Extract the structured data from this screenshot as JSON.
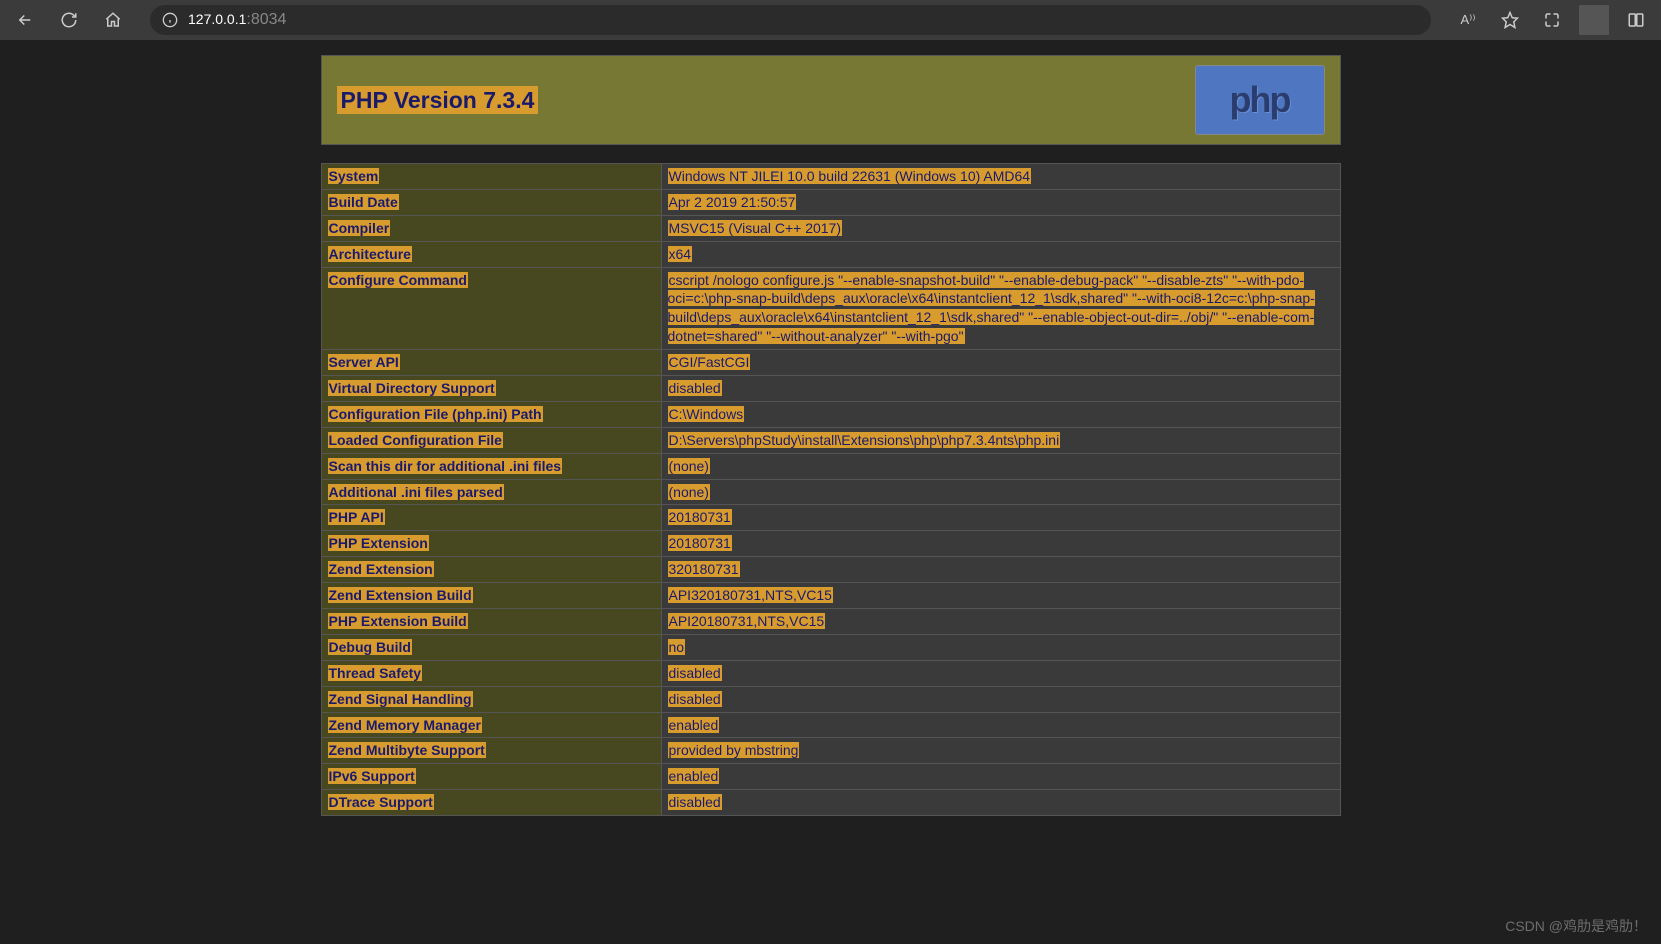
{
  "browser": {
    "url_host": "127.0.0.1",
    "url_port": ":8034",
    "read_aloud": "A⁾⁾"
  },
  "page": {
    "title": "PHP Version 7.3.4",
    "logo_text": "php"
  },
  "rows": [
    {
      "k": "System",
      "v": "Windows NT JILEI 10.0 build 22631 (Windows 10) AMD64"
    },
    {
      "k": "Build Date",
      "v": "Apr 2 2019 21:50:57"
    },
    {
      "k": "Compiler",
      "v": "MSVC15 (Visual C++ 2017)"
    },
    {
      "k": "Architecture",
      "v": "x64"
    },
    {
      "k": "Configure Command",
      "v": "cscript /nologo configure.js \"--enable-snapshot-build\" \"--enable-debug-pack\" \"--disable-zts\" \"--with-pdo-oci=c:\\php-snap-build\\deps_aux\\oracle\\x64\\instantclient_12_1\\sdk,shared\" \"--with-oci8-12c=c:\\php-snap-build\\deps_aux\\oracle\\x64\\instantclient_12_1\\sdk,shared\" \"--enable-object-out-dir=../obj/\" \"--enable-com-dotnet=shared\" \"--without-analyzer\" \"--with-pgo\""
    },
    {
      "k": "Server API",
      "v": "CGI/FastCGI"
    },
    {
      "k": "Virtual Directory Support",
      "v": "disabled"
    },
    {
      "k": "Configuration File (php.ini) Path",
      "v": "C:\\Windows"
    },
    {
      "k": "Loaded Configuration File",
      "v": "D:\\Servers\\phpStudy\\install\\Extensions\\php\\php7.3.4nts\\php.ini"
    },
    {
      "k": "Scan this dir for additional .ini files",
      "v": "(none)"
    },
    {
      "k": "Additional .ini files parsed",
      "v": "(none)"
    },
    {
      "k": "PHP API",
      "v": "20180731"
    },
    {
      "k": "PHP Extension",
      "v": "20180731"
    },
    {
      "k": "Zend Extension",
      "v": "320180731"
    },
    {
      "k": "Zend Extension Build",
      "v": "API320180731,NTS,VC15"
    },
    {
      "k": "PHP Extension Build",
      "v": "API20180731,NTS,VC15"
    },
    {
      "k": "Debug Build",
      "v": "no"
    },
    {
      "k": "Thread Safety",
      "v": "disabled"
    },
    {
      "k": "Zend Signal Handling",
      "v": "disabled"
    },
    {
      "k": "Zend Memory Manager",
      "v": "enabled"
    },
    {
      "k": "Zend Multibyte Support",
      "v": "provided by mbstring"
    },
    {
      "k": "IPv6 Support",
      "v": "enabled"
    },
    {
      "k": "DTrace Support",
      "v": "disabled"
    }
  ],
  "watermark": "CSDN @鸡肋是鸡肋！"
}
